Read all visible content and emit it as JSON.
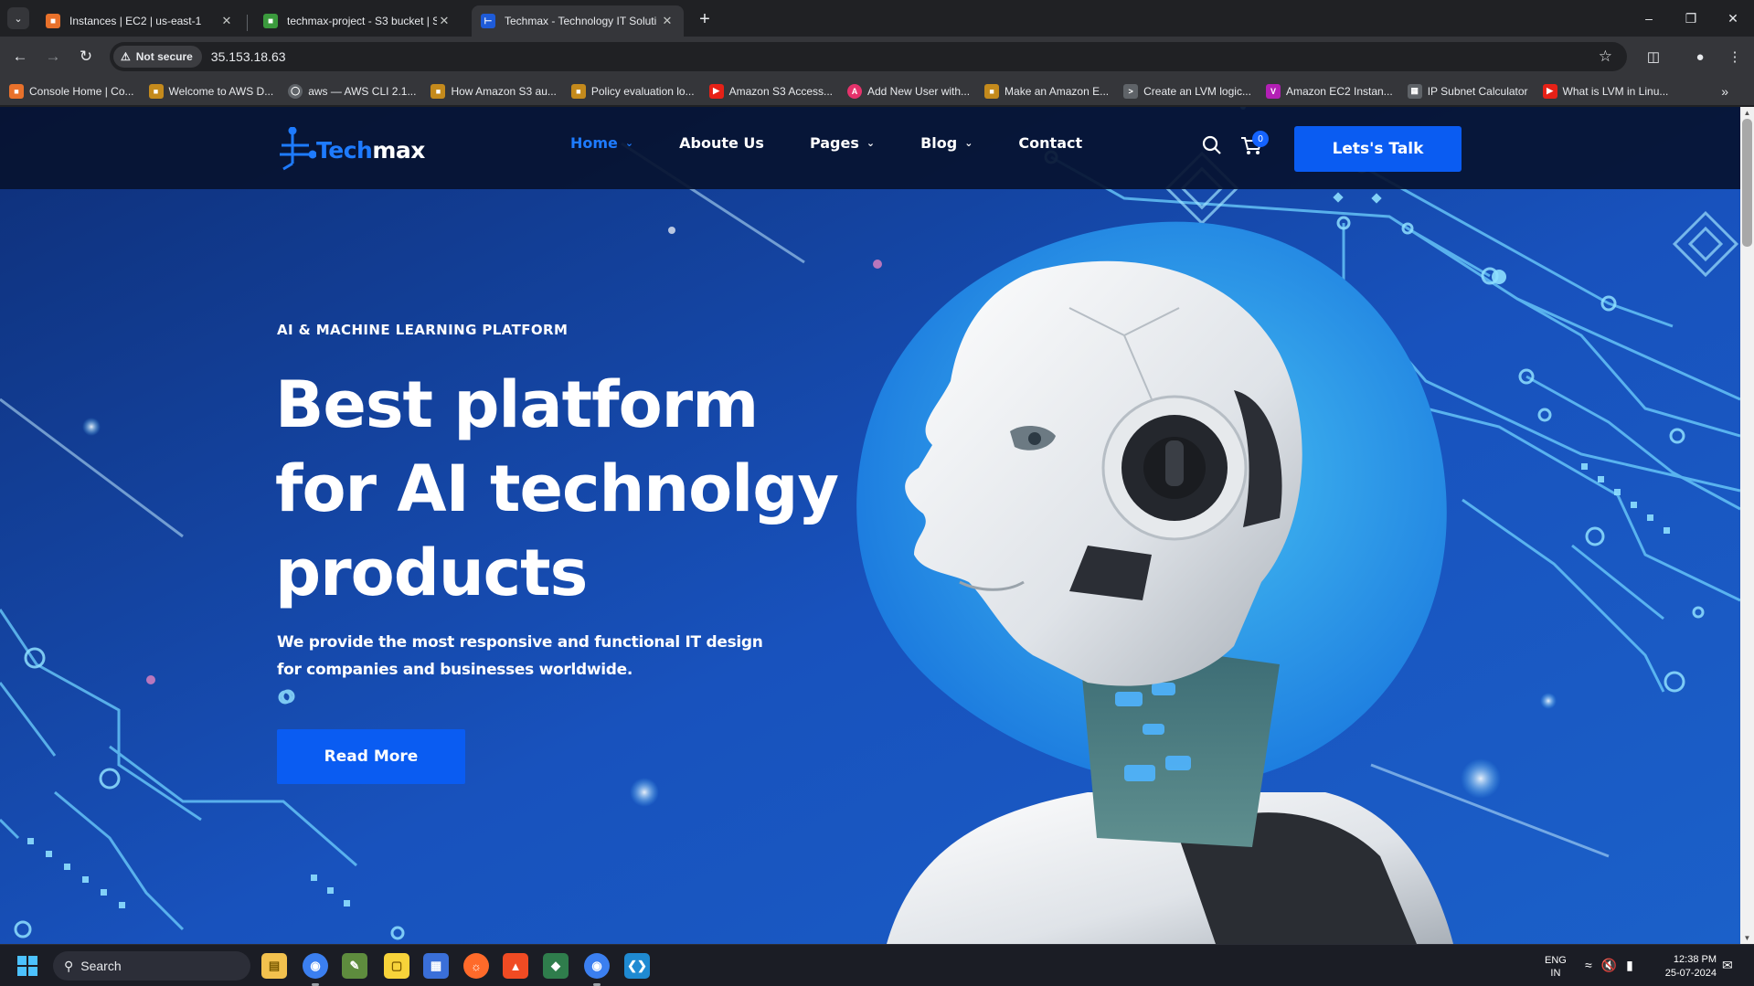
{
  "browser": {
    "tabs": [
      {
        "title": "Instances | EC2 | us-east-1",
        "icon": "aws-ec2-icon",
        "color": "#e8712b"
      },
      {
        "title": "techmax-project - S3 bucket | S",
        "icon": "aws-s3-icon",
        "color": "#3b9a3d"
      },
      {
        "title": "Techmax - Technology IT Soluti",
        "icon": "techmax-icon",
        "color": "#1e5bd8"
      }
    ],
    "security_label": "Not secure",
    "url": "35.153.18.63",
    "bookmarks": [
      {
        "label": "Console Home | Co...",
        "icon": "aws-cube-icon",
        "color": "#e8712b"
      },
      {
        "label": "Welcome to AWS D...",
        "icon": "aws-doc-icon",
        "color": "#c48a1c"
      },
      {
        "label": "aws — AWS CLI 2.1...",
        "icon": "globe-icon",
        "color": "#5f6368"
      },
      {
        "label": "How Amazon S3 au...",
        "icon": "aws-doc-icon",
        "color": "#c48a1c"
      },
      {
        "label": "Policy evaluation lo...",
        "icon": "aws-doc-icon",
        "color": "#c48a1c"
      },
      {
        "label": "Amazon S3 Access...",
        "icon": "youtube-icon",
        "color": "#e62117"
      },
      {
        "label": "Add New User with...",
        "icon": "a-icon",
        "color": "#e5326b"
      },
      {
        "label": "Make an Amazon E...",
        "icon": "aws-doc-icon",
        "color": "#c48a1c"
      },
      {
        "label": "Create an LVM logic...",
        "icon": "terminal-icon",
        "color": "#5f6368"
      },
      {
        "label": "Amazon EC2 Instan...",
        "icon": "v-icon",
        "color": "#b31fb5"
      },
      {
        "label": "IP Subnet Calculator",
        "icon": "calculator-icon",
        "color": "#5f6368"
      },
      {
        "label": "What is LVM in Linu...",
        "icon": "youtube-icon",
        "color": "#e62117"
      }
    ]
  },
  "site": {
    "logo": {
      "part1": "Tech",
      "part2": "max"
    },
    "nav": [
      {
        "label": "Home",
        "dropdown": true,
        "active": true
      },
      {
        "label": "Aboute Us",
        "dropdown": false,
        "active": false
      },
      {
        "label": "Pages",
        "dropdown": true,
        "active": false
      },
      {
        "label": "Blog",
        "dropdown": true,
        "active": false
      },
      {
        "label": "Contact",
        "dropdown": false,
        "active": false
      }
    ],
    "cart_count": "0",
    "cta_label": "Lets's Talk",
    "hero": {
      "eyebrow": "AI & MACHINE LEARNING PLATFORM",
      "headline": "Best platform for AI technolgy products",
      "subtext": "We provide the most responsive and functional IT design for companies and businesses worldwide.",
      "button_label": "Read More"
    },
    "colors": {
      "accent": "#0a5cf2",
      "header_bg": "#061230",
      "hero_bg": "#1a4fb8"
    }
  },
  "taskbar": {
    "search_placeholder": "Search",
    "apps": [
      "file-explorer-icon",
      "chrome-icon",
      "notepad-icon",
      "sticky-notes-icon",
      "store-icon",
      "firefox-icon",
      "brave-icon",
      "git-icon",
      "chrome-profile-icon",
      "vscode-icon"
    ],
    "language": {
      "line1": "ENG",
      "line2": "IN"
    },
    "time": "12:38 PM",
    "date": "25-07-2024"
  }
}
